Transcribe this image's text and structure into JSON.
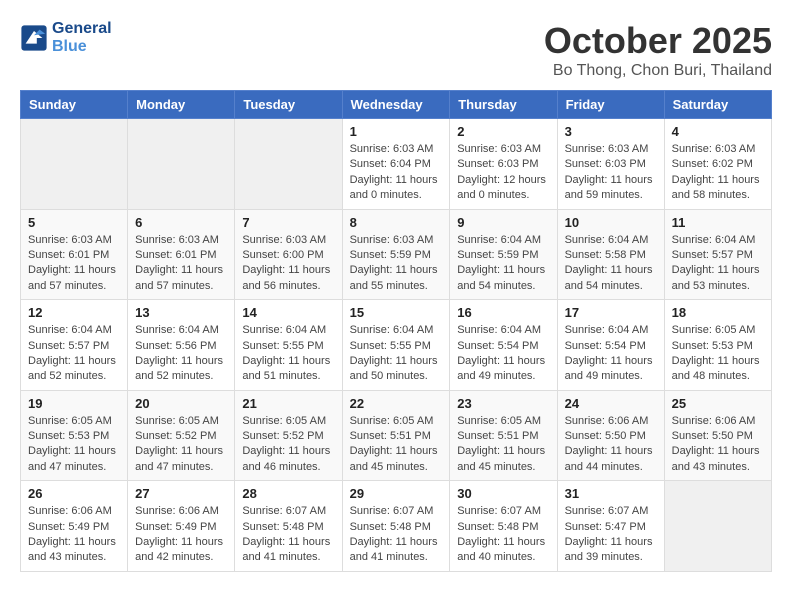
{
  "header": {
    "logo_line1": "General",
    "logo_line2": "Blue",
    "month": "October 2025",
    "location": "Bo Thong, Chon Buri, Thailand"
  },
  "weekdays": [
    "Sunday",
    "Monday",
    "Tuesday",
    "Wednesday",
    "Thursday",
    "Friday",
    "Saturday"
  ],
  "weeks": [
    [
      {
        "day": "",
        "info": ""
      },
      {
        "day": "",
        "info": ""
      },
      {
        "day": "",
        "info": ""
      },
      {
        "day": "1",
        "info": "Sunrise: 6:03 AM\nSunset: 6:04 PM\nDaylight: 11 hours\nand 0 minutes."
      },
      {
        "day": "2",
        "info": "Sunrise: 6:03 AM\nSunset: 6:03 PM\nDaylight: 12 hours\nand 0 minutes."
      },
      {
        "day": "3",
        "info": "Sunrise: 6:03 AM\nSunset: 6:03 PM\nDaylight: 11 hours\nand 59 minutes."
      },
      {
        "day": "4",
        "info": "Sunrise: 6:03 AM\nSunset: 6:02 PM\nDaylight: 11 hours\nand 58 minutes."
      }
    ],
    [
      {
        "day": "5",
        "info": "Sunrise: 6:03 AM\nSunset: 6:01 PM\nDaylight: 11 hours\nand 57 minutes."
      },
      {
        "day": "6",
        "info": "Sunrise: 6:03 AM\nSunset: 6:01 PM\nDaylight: 11 hours\nand 57 minutes."
      },
      {
        "day": "7",
        "info": "Sunrise: 6:03 AM\nSunset: 6:00 PM\nDaylight: 11 hours\nand 56 minutes."
      },
      {
        "day": "8",
        "info": "Sunrise: 6:03 AM\nSunset: 5:59 PM\nDaylight: 11 hours\nand 55 minutes."
      },
      {
        "day": "9",
        "info": "Sunrise: 6:04 AM\nSunset: 5:59 PM\nDaylight: 11 hours\nand 54 minutes."
      },
      {
        "day": "10",
        "info": "Sunrise: 6:04 AM\nSunset: 5:58 PM\nDaylight: 11 hours\nand 54 minutes."
      },
      {
        "day": "11",
        "info": "Sunrise: 6:04 AM\nSunset: 5:57 PM\nDaylight: 11 hours\nand 53 minutes."
      }
    ],
    [
      {
        "day": "12",
        "info": "Sunrise: 6:04 AM\nSunset: 5:57 PM\nDaylight: 11 hours\nand 52 minutes."
      },
      {
        "day": "13",
        "info": "Sunrise: 6:04 AM\nSunset: 5:56 PM\nDaylight: 11 hours\nand 52 minutes."
      },
      {
        "day": "14",
        "info": "Sunrise: 6:04 AM\nSunset: 5:55 PM\nDaylight: 11 hours\nand 51 minutes."
      },
      {
        "day": "15",
        "info": "Sunrise: 6:04 AM\nSunset: 5:55 PM\nDaylight: 11 hours\nand 50 minutes."
      },
      {
        "day": "16",
        "info": "Sunrise: 6:04 AM\nSunset: 5:54 PM\nDaylight: 11 hours\nand 49 minutes."
      },
      {
        "day": "17",
        "info": "Sunrise: 6:04 AM\nSunset: 5:54 PM\nDaylight: 11 hours\nand 49 minutes."
      },
      {
        "day": "18",
        "info": "Sunrise: 6:05 AM\nSunset: 5:53 PM\nDaylight: 11 hours\nand 48 minutes."
      }
    ],
    [
      {
        "day": "19",
        "info": "Sunrise: 6:05 AM\nSunset: 5:53 PM\nDaylight: 11 hours\nand 47 minutes."
      },
      {
        "day": "20",
        "info": "Sunrise: 6:05 AM\nSunset: 5:52 PM\nDaylight: 11 hours\nand 47 minutes."
      },
      {
        "day": "21",
        "info": "Sunrise: 6:05 AM\nSunset: 5:52 PM\nDaylight: 11 hours\nand 46 minutes."
      },
      {
        "day": "22",
        "info": "Sunrise: 6:05 AM\nSunset: 5:51 PM\nDaylight: 11 hours\nand 45 minutes."
      },
      {
        "day": "23",
        "info": "Sunrise: 6:05 AM\nSunset: 5:51 PM\nDaylight: 11 hours\nand 45 minutes."
      },
      {
        "day": "24",
        "info": "Sunrise: 6:06 AM\nSunset: 5:50 PM\nDaylight: 11 hours\nand 44 minutes."
      },
      {
        "day": "25",
        "info": "Sunrise: 6:06 AM\nSunset: 5:50 PM\nDaylight: 11 hours\nand 43 minutes."
      }
    ],
    [
      {
        "day": "26",
        "info": "Sunrise: 6:06 AM\nSunset: 5:49 PM\nDaylight: 11 hours\nand 43 minutes."
      },
      {
        "day": "27",
        "info": "Sunrise: 6:06 AM\nSunset: 5:49 PM\nDaylight: 11 hours\nand 42 minutes."
      },
      {
        "day": "28",
        "info": "Sunrise: 6:07 AM\nSunset: 5:48 PM\nDaylight: 11 hours\nand 41 minutes."
      },
      {
        "day": "29",
        "info": "Sunrise: 6:07 AM\nSunset: 5:48 PM\nDaylight: 11 hours\nand 41 minutes."
      },
      {
        "day": "30",
        "info": "Sunrise: 6:07 AM\nSunset: 5:48 PM\nDaylight: 11 hours\nand 40 minutes."
      },
      {
        "day": "31",
        "info": "Sunrise: 6:07 AM\nSunset: 5:47 PM\nDaylight: 11 hours\nand 39 minutes."
      },
      {
        "day": "",
        "info": ""
      }
    ]
  ]
}
